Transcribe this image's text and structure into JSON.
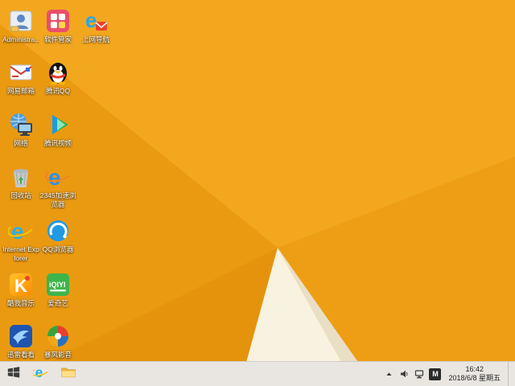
{
  "wallpaper": {
    "base": "#f2a41d",
    "facet_top": "#f3a71f",
    "facet_left": "#ea9a11",
    "facet_bottom_left": "#e5930c",
    "facet_right": "#ee9e15",
    "facet_cream": "#f8f2e0",
    "facet_beige": "#e9dfc6"
  },
  "desktop": {
    "icons": [
      {
        "name": "user-files",
        "label": "Administra..."
      },
      {
        "name": "software-manager",
        "label": "软件管家"
      },
      {
        "name": "web-navigation",
        "label": "上网导航"
      },
      {
        "name": "mail",
        "label": "网易邮箱"
      },
      {
        "name": "tencent-qq",
        "label": "腾讯QQ"
      },
      {
        "name": "network",
        "label": "网络"
      },
      {
        "name": "tencent-video",
        "label": "腾讯视频"
      },
      {
        "name": "recycle-bin",
        "label": "回收站"
      },
      {
        "name": "browser-2345",
        "label": "2345加速浏览器"
      },
      {
        "name": "internet-explorer",
        "label": "Internet Explorer"
      },
      {
        "name": "qq-browser",
        "label": "QQ浏览器"
      },
      {
        "name": "kuwo-music",
        "label": "酷我音乐"
      },
      {
        "name": "iqiyi",
        "label": "爱奇艺"
      },
      {
        "name": "xunlei-kankan",
        "label": "迅雷看看"
      },
      {
        "name": "baofeng-player",
        "label": "暴风影音"
      }
    ]
  },
  "taskbar": {
    "tray": {
      "input_indicator": "M"
    },
    "clock": {
      "time": "16:42",
      "date": "2018/6/8 星期五"
    }
  }
}
